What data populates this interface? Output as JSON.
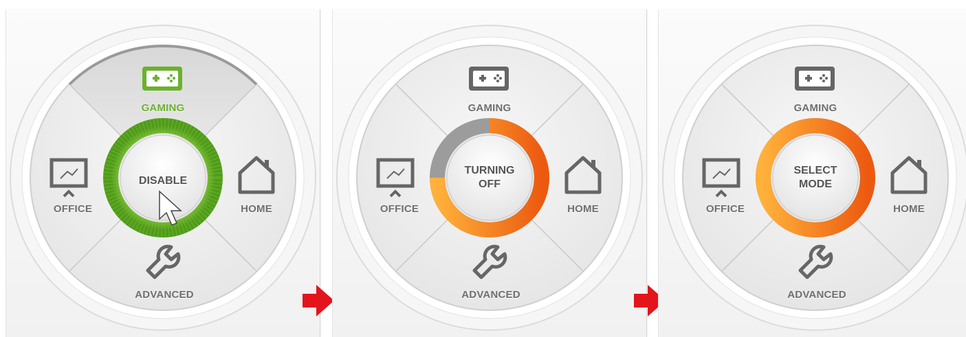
{
  "accent_colors": {
    "active_green": "#6bb22c",
    "ring_orange": "#f27a12",
    "arrow_red": "#e3141b"
  },
  "panels": [
    {
      "center": {
        "lines": [
          "DISABLE",
          ""
        ],
        "ring": "green",
        "progress": null
      },
      "modes": {
        "gaming": {
          "label": "GAMING",
          "icon": "gamepad-icon",
          "selected": true
        },
        "office": {
          "label": "OFFICE",
          "icon": "presentation-board-icon"
        },
        "home": {
          "label": "HOME",
          "icon": "house-icon"
        },
        "advanced": {
          "label": "ADVANCED",
          "icon": "wrench-icon"
        }
      },
      "cursor": "arrow-cursor-icon"
    },
    {
      "center": {
        "lines": [
          "TURNING",
          "OFF"
        ],
        "ring": "orange",
        "progress": 0.75
      },
      "modes": {
        "gaming": {
          "label": "GAMING",
          "icon": "gamepad-icon"
        },
        "office": {
          "label": "OFFICE",
          "icon": "presentation-board-icon"
        },
        "home": {
          "label": "HOME",
          "icon": "house-icon"
        },
        "advanced": {
          "label": "ADVANCED",
          "icon": "wrench-icon"
        }
      }
    },
    {
      "center": {
        "lines": [
          "SELECT",
          "MODE"
        ],
        "ring": "orange",
        "progress": 1
      },
      "modes": {
        "gaming": {
          "label": "GAMING",
          "icon": "gamepad-icon"
        },
        "office": {
          "label": "OFFICE",
          "icon": "presentation-board-icon"
        },
        "home": {
          "label": "HOME",
          "icon": "house-icon"
        },
        "advanced": {
          "label": "ADVANCED",
          "icon": "wrench-icon"
        }
      }
    }
  ],
  "transition_arrow": "right-arrow-icon"
}
